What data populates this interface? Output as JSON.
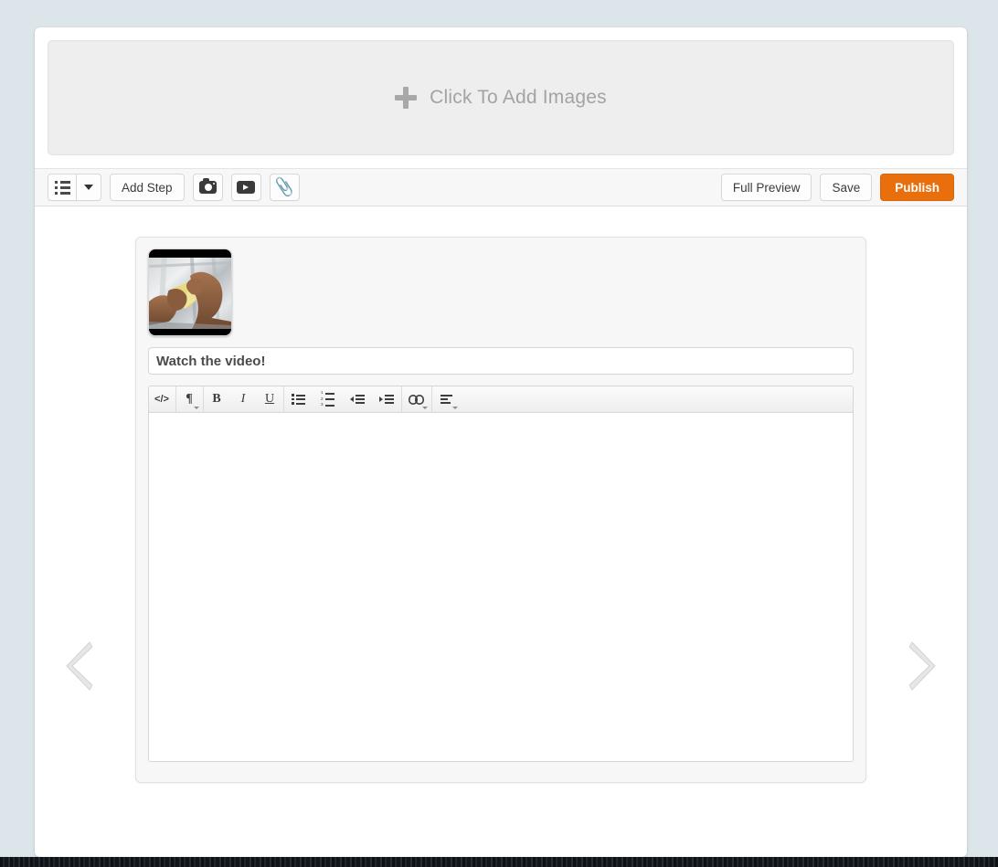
{
  "page": {
    "background_color": "#dce5e9",
    "card_background": "#ffffff"
  },
  "dropzone": {
    "label": "Click To Add Images",
    "icon": "plus-icon",
    "background_color": "#eeeeee",
    "text_color": "#a3a3a3"
  },
  "toolbar": {
    "left": [
      {
        "name": "list-view-button",
        "icon": "bulleted-list-icon",
        "label": ""
      },
      {
        "name": "list-view-dropdown",
        "icon": "caret-down-icon",
        "label": ""
      },
      {
        "name": "add-step-button",
        "icon": "",
        "label": "Add Step"
      },
      {
        "name": "add-photo-button",
        "icon": "camera-icon",
        "label": ""
      },
      {
        "name": "add-video-button",
        "icon": "video-play-icon",
        "label": ""
      },
      {
        "name": "add-attachment-button",
        "icon": "paperclip-icon",
        "label": ""
      }
    ],
    "right": [
      {
        "name": "full-preview-button",
        "label": "Full Preview",
        "style": "default"
      },
      {
        "name": "save-button",
        "label": "Save",
        "style": "default"
      },
      {
        "name": "publish-button",
        "label": "Publish",
        "style": "primary"
      }
    ],
    "primary_color": "#e96f0d",
    "background_color": "#f7f7f7"
  },
  "navigation": {
    "prev_label": "Previous step",
    "prev_icon": "chevron-left-icon",
    "next_label": "Next step",
    "next_icon": "chevron-right-icon",
    "arrow_color": "#e2e2e2"
  },
  "step": {
    "thumbnail": {
      "name": "step-thumbnail",
      "alt": "Hands folding yellow paper on a silver foil surface",
      "letterboxed": true
    },
    "title_value": "Watch the video!",
    "title_placeholder": "Step title",
    "editor": {
      "content": "",
      "placeholder": "",
      "groups": [
        {
          "name": "source-group",
          "buttons": [
            {
              "name": "html-source-button",
              "icon": "code-icon",
              "glyph": "</>",
              "caret": false
            }
          ]
        },
        {
          "name": "paragraph-group",
          "buttons": [
            {
              "name": "paragraph-format-button",
              "icon": "pilcrow-icon",
              "glyph": "¶",
              "caret": true
            }
          ]
        },
        {
          "name": "text-style-group",
          "buttons": [
            {
              "name": "bold-button",
              "icon": "bold-icon",
              "glyph": "B",
              "caret": false
            },
            {
              "name": "italic-button",
              "icon": "italic-icon",
              "glyph": "I",
              "caret": false
            },
            {
              "name": "underline-button",
              "icon": "underline-icon",
              "glyph": "U",
              "caret": false
            }
          ]
        },
        {
          "name": "list-group",
          "buttons": [
            {
              "name": "unordered-list-button",
              "icon": "bullet-list-icon",
              "glyph": "",
              "caret": false
            },
            {
              "name": "ordered-list-button",
              "icon": "numbered-list-icon",
              "glyph": "",
              "caret": false
            },
            {
              "name": "outdent-button",
              "icon": "outdent-icon",
              "glyph": "",
              "caret": false
            },
            {
              "name": "indent-button",
              "icon": "indent-icon",
              "glyph": "",
              "caret": false
            }
          ]
        },
        {
          "name": "link-group",
          "buttons": [
            {
              "name": "insert-link-button",
              "icon": "link-chain-icon",
              "glyph": "",
              "caret": true
            }
          ]
        },
        {
          "name": "align-group",
          "buttons": [
            {
              "name": "text-align-button",
              "icon": "align-left-icon",
              "glyph": "",
              "caret": true
            }
          ]
        }
      ]
    }
  }
}
